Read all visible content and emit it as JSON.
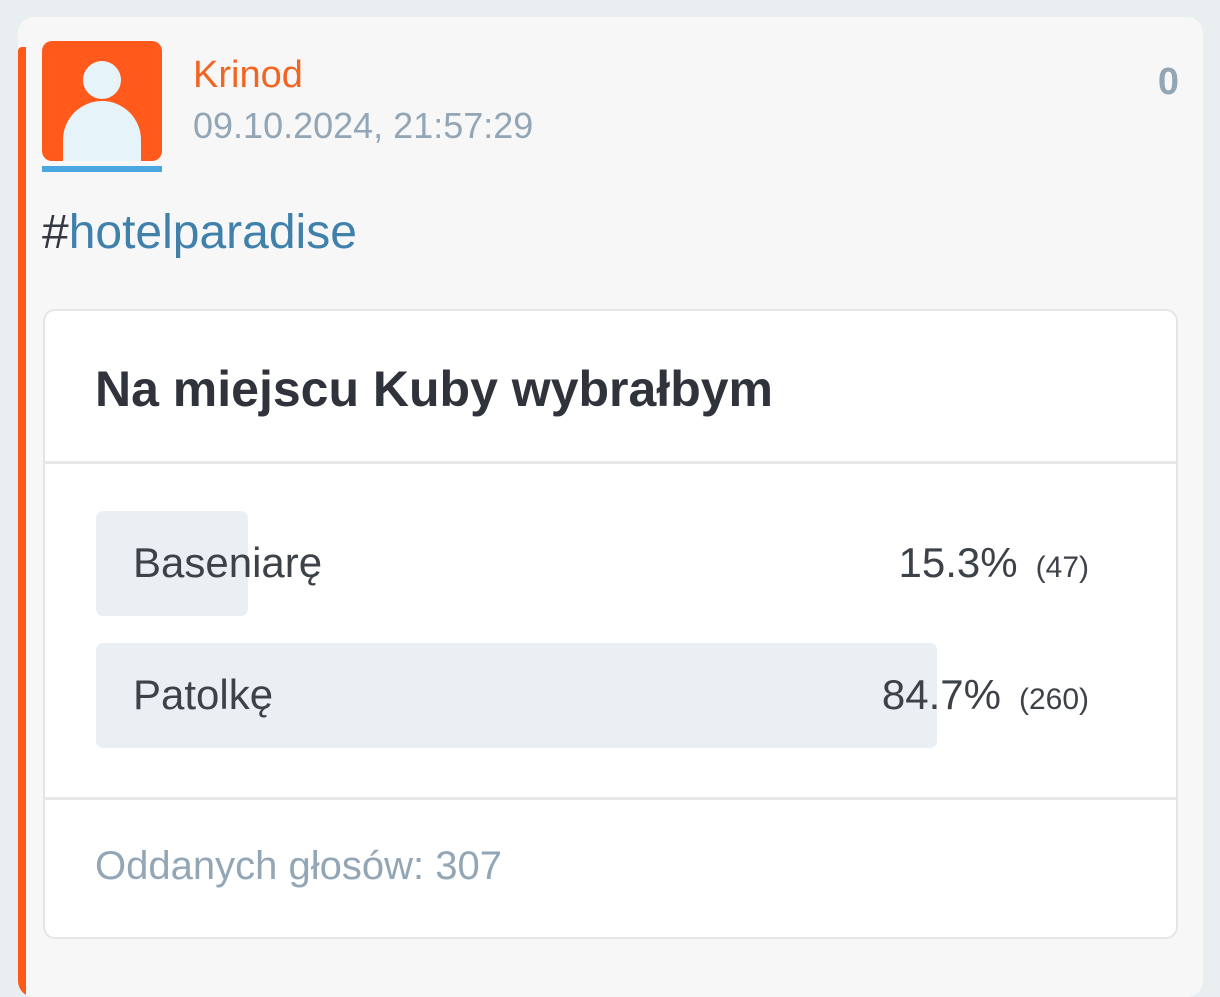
{
  "post": {
    "author": "Krinod",
    "timestamp": "09.10.2024, 21:57:29",
    "score": "0",
    "tag_hash": "#",
    "tag_name": "hotelparadise"
  },
  "poll": {
    "title": "Na miejscu Kuby wybrałbym",
    "options": [
      {
        "label": "Baseniarę",
        "percent": "15.3%",
        "count": "(47)",
        "fraction": 0.153
      },
      {
        "label": "Patolkę",
        "percent": "84.7%",
        "count": "(260)",
        "fraction": 0.847
      }
    ],
    "footer": "Oddanych głosów: 307"
  },
  "colors": {
    "accent": "#ff5917",
    "author": "#f26522",
    "tag": "#3f81ab",
    "muted": "#93a6b6",
    "bar_fill": "#eaeff3"
  },
  "icons": {
    "avatar": "user-silhouette-icon"
  }
}
